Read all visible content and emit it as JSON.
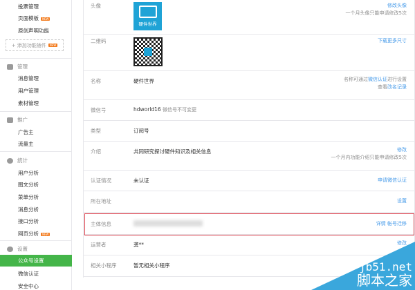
{
  "sidebar": {
    "top_items": [
      {
        "label": "投票管理"
      },
      {
        "label": "页面模板",
        "badge": "NEW"
      },
      {
        "label": "原创声明功能"
      }
    ],
    "add_plugin": {
      "label": "+ 添加功能插件",
      "badge": "NEW"
    },
    "sections": [
      {
        "title": "管理",
        "icon": "inbox-icon",
        "items": [
          "消息管理",
          "用户管理",
          "素材管理"
        ]
      },
      {
        "title": "推广",
        "icon": "megaphone-icon",
        "items": [
          "广告主",
          "流量主"
        ]
      },
      {
        "title": "统计",
        "icon": "chart-icon",
        "items": [
          "用户分析",
          "图文分析",
          "菜单分析",
          "消息分析",
          "接口分析",
          "网页分析"
        ],
        "badge": "NEW"
      },
      {
        "title": "设置",
        "icon": "gear-icon",
        "items": [
          "公众号设置",
          "微信认证",
          "安全中心"
        ]
      }
    ]
  },
  "main": {
    "avatar": {
      "label": "头像",
      "logo_text": "硬件世界",
      "action": "修改头像",
      "note": "一个月头像只能申请修改5次"
    },
    "qrcode": {
      "label": "二维码",
      "action": "下载更多尺寸"
    },
    "name": {
      "label": "名称",
      "value": "硬件世界",
      "note_pre": "名称可通过",
      "note_link": "微信认证",
      "note_post": "进行设置",
      "note2_pre": "查看",
      "note2_link": "改名记录"
    },
    "wechat_id": {
      "label": "微信号",
      "value": "hdworld16",
      "note": "微信号不可变更"
    },
    "type": {
      "label": "类型",
      "value": "订阅号"
    },
    "intro": {
      "label": "介绍",
      "value": "共同研究探讨硬件知识及相关信息",
      "action": "修改",
      "note": "一个月内功能介绍只能申请修改5次"
    },
    "verify": {
      "label": "认证情况",
      "value": "未认证",
      "action": "申请微信认证"
    },
    "address": {
      "label": "所在地址",
      "action": "设置"
    },
    "entity": {
      "label": "主体信息",
      "action1": "详情",
      "action2": "帐号迁移"
    },
    "operator": {
      "label": "运营者",
      "value": "龚**",
      "action": "修改"
    },
    "miniprogram": {
      "label": "相关小程序",
      "value": "暂无相关小程序"
    }
  },
  "watermark": {
    "line1": "jb51.net",
    "line2": "脚本之家"
  }
}
